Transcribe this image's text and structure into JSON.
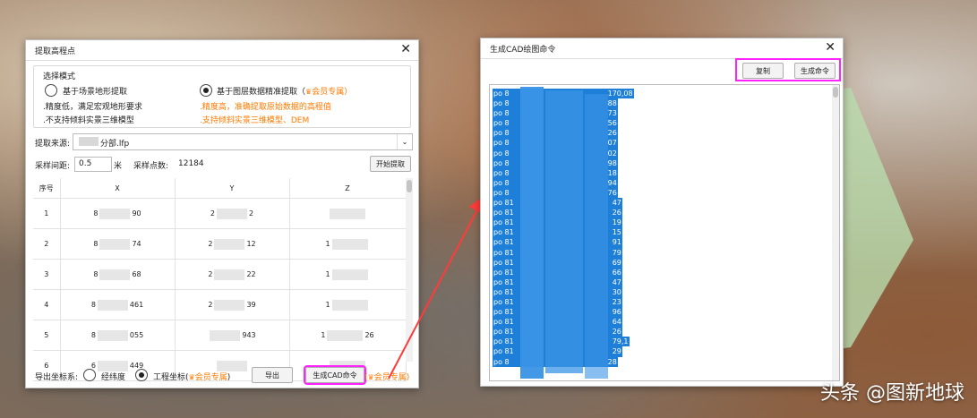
{
  "left_dialog": {
    "title": "提取高程点",
    "mode_group_label": "选择模式",
    "mode_scene": {
      "label": "基于场景地形提取",
      "line1": ".精度低，满足宏观地形要求",
      "line2": ".不支持倾斜实景三维模型"
    },
    "mode_layer": {
      "label": "基于图层数据精准提取（",
      "vip": "会员专属",
      "close_paren": "）",
      "line1": ".精度高，准确提取原始数据的高程值",
      "line2": ".支持倾斜实景三维模型、DEM"
    },
    "source_label": "提取来源:",
    "source_value": "分部.lfp",
    "interval_label": "采样间距:",
    "interval_value": "0.5",
    "interval_unit": "米",
    "count_label": "采样点数:",
    "count_value": "12184",
    "start_button": "开始提取",
    "table": {
      "headers": [
        "序号",
        "X",
        "Y",
        "Z"
      ],
      "rows": [
        {
          "n": "1",
          "x_pre": "8",
          "x_suf": "90",
          "y_pre": "2",
          "y_suf": "2",
          "z_pre": "",
          "z_suf": ""
        },
        {
          "n": "2",
          "x_pre": "8",
          "x_suf": "74",
          "y_pre": "2",
          "y_suf": "12",
          "z_pre": "1",
          "z_suf": ""
        },
        {
          "n": "3",
          "x_pre": "8",
          "x_suf": "68",
          "y_pre": "2",
          "y_suf": "22",
          "z_pre": "1",
          "z_suf": ""
        },
        {
          "n": "4",
          "x_pre": "8",
          "x_suf": "461",
          "y_pre": "2",
          "y_suf": "39",
          "z_pre": "1",
          "z_suf": ""
        },
        {
          "n": "5",
          "x_pre": "8",
          "x_suf": "055",
          "y_pre": "",
          "y_suf": "943",
          "z_pre": "1",
          "z_suf": "26"
        },
        {
          "n": "6",
          "x_pre": "6",
          "x_suf": "449",
          "y_pre": "",
          "y_suf": "",
          "z_pre": "",
          "z_suf": ""
        }
      ]
    },
    "export_coord_label": "导出坐标系:",
    "opt_latlon": "经纬度",
    "opt_project": "工程坐标(",
    "opt_project_vip": "会员专属",
    "opt_project_close": ")",
    "export_button": "导出",
    "cad_button": "生成CAD命令",
    "cad_vip": "会员专属",
    "cad_vip_paren": "(",
    "cad_vip_close": ")"
  },
  "right_dialog": {
    "title": "生成CAD绘图命令",
    "copy_button": "复制",
    "gen_button": "生成命令",
    "lines": [
      {
        "p": "po 8",
        "e": "170,08"
      },
      {
        "p": "po 8",
        "e": "88"
      },
      {
        "p": "po 8",
        "e": "73"
      },
      {
        "p": "po 8",
        "e": "56"
      },
      {
        "p": "po 8",
        "e": "26"
      },
      {
        "p": "po 8",
        "e": "07"
      },
      {
        "p": "po 8",
        "e": "02"
      },
      {
        "p": "po 8",
        "e": "98"
      },
      {
        "p": "po 8",
        "e": "18"
      },
      {
        "p": "po 8",
        "e": "94"
      },
      {
        "p": "po 8",
        "e": "76"
      },
      {
        "p": "po 81",
        "e": "47"
      },
      {
        "p": "po 81",
        "e": "26"
      },
      {
        "p": "po 81",
        "e": "19"
      },
      {
        "p": "po 81",
        "e": "15"
      },
      {
        "p": "po 81",
        "e": "91"
      },
      {
        "p": "po 81",
        "e": "79"
      },
      {
        "p": "po 81",
        "e": "69"
      },
      {
        "p": "po 81",
        "e": "66"
      },
      {
        "p": "po 81",
        "e": "47"
      },
      {
        "p": "po 81",
        "e": "30"
      },
      {
        "p": "po 81",
        "e": "23"
      },
      {
        "p": "po 81",
        "e": "96"
      },
      {
        "p": "po 81",
        "e": "64"
      },
      {
        "p": "po 81",
        "e": "26"
      },
      {
        "p": "po 81",
        "e": "79,1"
      },
      {
        "p": "po 81",
        "e": "29"
      },
      {
        "p": "po 8",
        "e": "28"
      }
    ]
  },
  "watermark": "头条 @图新地球",
  "colors": {
    "highlight": "#ff22ff",
    "vip": "#ff7a00",
    "selection": "#1e7fd8",
    "arrow": "#ff3b3b"
  }
}
